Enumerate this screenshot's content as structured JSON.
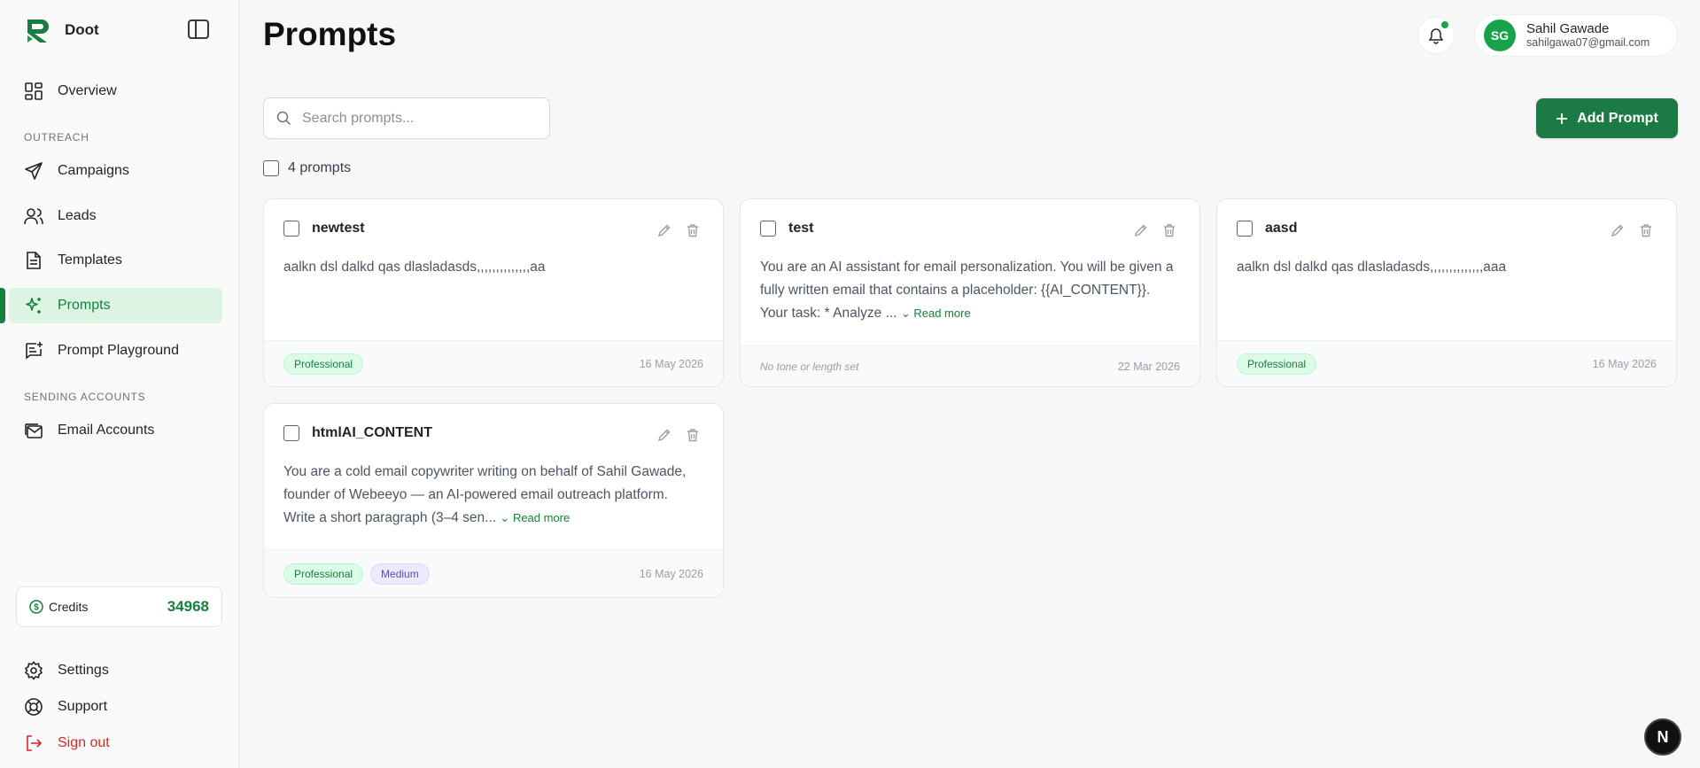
{
  "brand": {
    "name": "Doot"
  },
  "nav": {
    "overview": "Overview",
    "outreach_label": "OUTREACH",
    "campaigns": "Campaigns",
    "leads": "Leads",
    "templates": "Templates",
    "prompts": "Prompts",
    "playground": "Prompt Playground",
    "sending_label": "SENDING ACCOUNTS",
    "email_accounts": "Email Accounts",
    "settings": "Settings",
    "support": "Support",
    "signout": "Sign out"
  },
  "credits": {
    "label": "Credits",
    "value": "34968"
  },
  "header": {
    "title": "Prompts"
  },
  "user": {
    "initials": "SG",
    "name": "Sahil Gawade",
    "email": "sahilgawa07@gmail.com"
  },
  "search": {
    "placeholder": "Search prompts..."
  },
  "add_button": "Add Prompt",
  "count_label": "4 prompts",
  "read_more": "Read more",
  "cards": [
    {
      "title": "newtest",
      "body": "aalkn dsl dalkd qas dlasladasds,,,,,,,,,,,,,,aa",
      "tags": [
        "Professional"
      ],
      "date": "16 May 2026"
    },
    {
      "title": "test",
      "body": "You are an AI assistant for email personalization. You will be given a fully written email that contains a placeholder: {{AI_CONTENT}}. Your task: * Analyze ...",
      "note": "No tone or length set",
      "date": "22 Mar 2026"
    },
    {
      "title": "aasd",
      "body": "aalkn dsl dalkd qas dlasladasds,,,,,,,,,,,,,,aaa",
      "tags": [
        "Professional"
      ],
      "date": "16 May 2026"
    },
    {
      "title": "htmlAI_CONTENT",
      "body": "You are a cold email copywriter writing on behalf of Sahil Gawade, founder of Webeeyo — an AI-powered email outreach platform. Write a short paragraph (3–4 sen...",
      "tags": [
        "Professional",
        "Medium"
      ],
      "date": "16 May 2026"
    }
  ],
  "fab_letter": "N",
  "colors": {
    "accent": "#16803c",
    "active_bg": "#dcf5e3",
    "danger": "#dc2626"
  }
}
